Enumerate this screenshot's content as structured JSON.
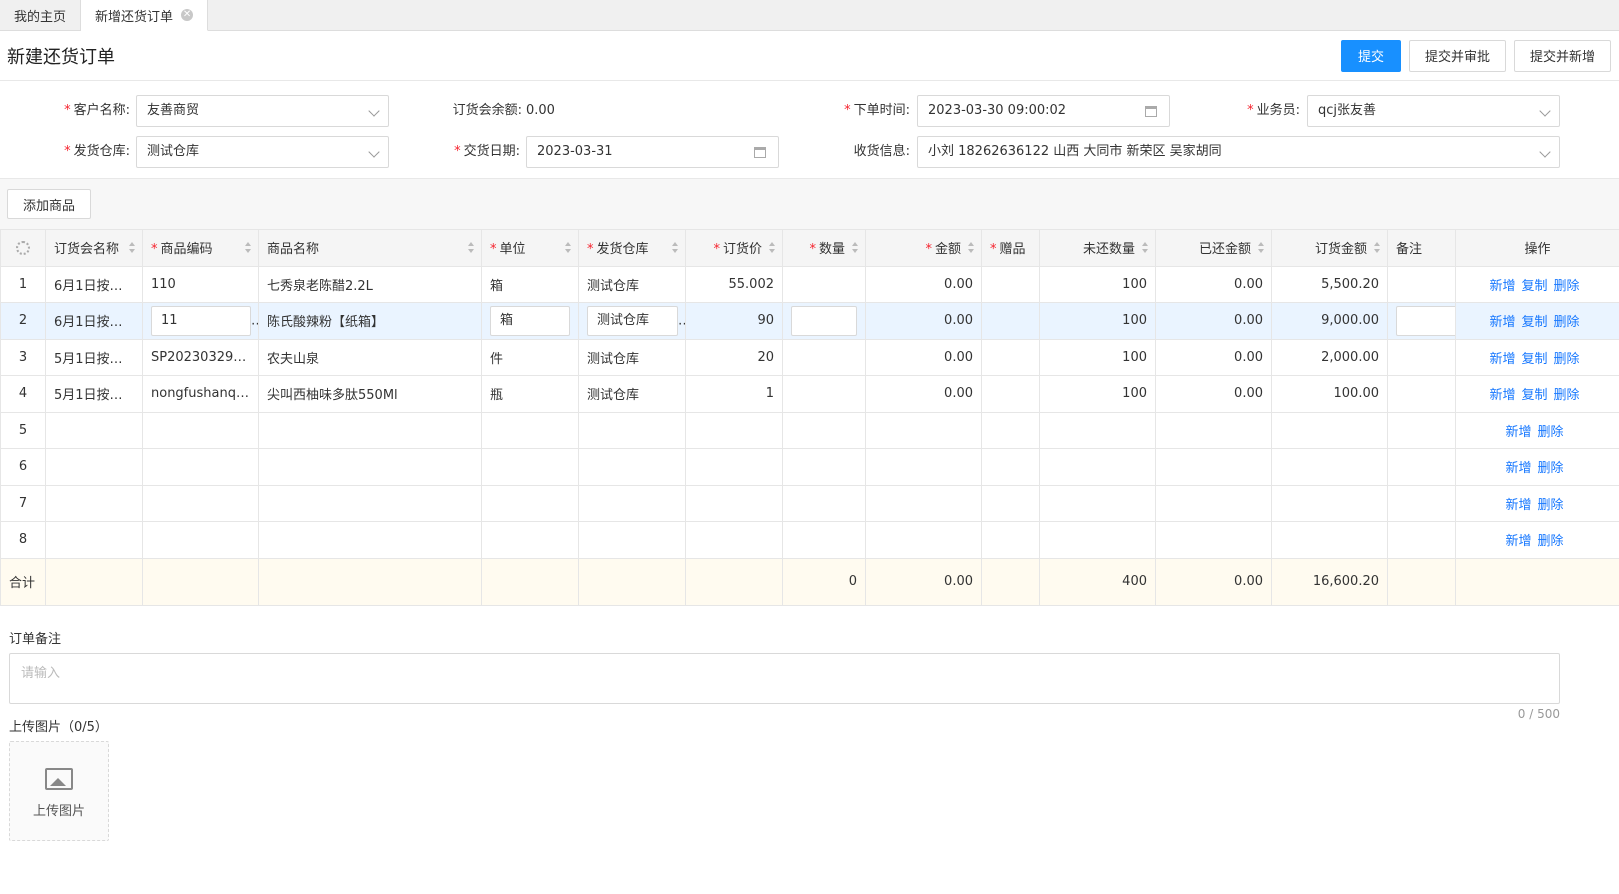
{
  "tabs": [
    {
      "label": "我的主页"
    },
    {
      "label": "新增还货订单"
    }
  ],
  "header": {
    "title": "新建还货订单",
    "submit": "提交",
    "submit_approve": "提交并审批",
    "submit_new": "提交并新增"
  },
  "form": {
    "customer_label": "客户名称:",
    "customer_value": "友善商贸",
    "balance_label": "订货会余额:",
    "balance_value": "0.00",
    "order_time_label": "下单时间:",
    "order_time_value": "2023-03-30 09:00:02",
    "salesman_label": "业务员:",
    "salesman_value": "qcj张友善",
    "warehouse_label": "发货仓库:",
    "warehouse_value": "测试仓库",
    "delivery_date_label": "交货日期:",
    "delivery_date_value": "2023-03-31",
    "receive_label": "收货信息:",
    "receive_value": "小刘 18262636122 山西 大同市 新荣区 吴家胡同"
  },
  "add_goods": "添加商品",
  "table": {
    "columns": [
      "订货会名称",
      "商品编码",
      "商品名称",
      "单位",
      "发货仓库",
      "订货价",
      "数量",
      "金额",
      "赠品",
      "未还数量",
      "已还金额",
      "订货金额",
      "备注",
      "操作"
    ],
    "rows": [
      {
        "no": "1",
        "meeting": "6月1日按商...",
        "code": "110",
        "name": "七秀泉老陈醋2.2L",
        "unit": "箱",
        "wh": "测试仓库",
        "price": "55.002",
        "qty": "",
        "amount": "0.00",
        "gift": "",
        "unreturned": "100",
        "returned": "0.00",
        "order_amount": "5,500.20",
        "remark": ""
      },
      {
        "no": "2",
        "meeting": "6月1日按商...",
        "code": "11",
        "name": "陈氏酸辣粉【纸箱】",
        "unit": "箱",
        "wh": "测试仓库",
        "price": "90",
        "qty": "",
        "amount": "0.00",
        "gift": "",
        "unreturned": "100",
        "returned": "0.00",
        "order_amount": "9,000.00",
        "remark": ""
      },
      {
        "no": "3",
        "meeting": "5月1日按商...",
        "code": "SP202303290...",
        "name": "农夫山泉",
        "unit": "件",
        "wh": "测试仓库",
        "price": "20",
        "qty": "",
        "amount": "0.00",
        "gift": "",
        "unreturned": "100",
        "returned": "0.00",
        "order_amount": "2,000.00",
        "remark": ""
      },
      {
        "no": "4",
        "meeting": "5月1日按商...",
        "code": "nongfushanqu...",
        "name": "尖叫西柚味多肽550Ml",
        "unit": "瓶",
        "wh": "测试仓库",
        "price": "1",
        "qty": "",
        "amount": "0.00",
        "gift": "",
        "unreturned": "100",
        "returned": "0.00",
        "order_amount": "100.00",
        "remark": ""
      }
    ],
    "empty_rows": [
      "5",
      "6",
      "7",
      "8"
    ],
    "op_add": "新增",
    "op_copy": "复制",
    "op_delete": "删除",
    "total": {
      "label": "合计",
      "qty": "0",
      "amount": "0.00",
      "unreturned": "400",
      "returned": "0.00",
      "order_amount": "16,600.20"
    }
  },
  "notes": {
    "label": "订单备注",
    "placeholder": "请输入",
    "counter": "0 / 500"
  },
  "upload": {
    "label": "上传图片（0/5）",
    "button": "上传图片"
  }
}
